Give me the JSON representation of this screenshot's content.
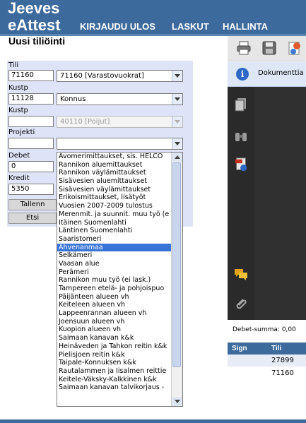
{
  "header": {
    "logo_line1": "Jeeves",
    "logo_line2": "eAttest",
    "nav": [
      "KIRJAUDU ULOS",
      "LASKUT",
      "HALLINTA"
    ]
  },
  "page_title": "Uusi tiliöinti",
  "form": {
    "tili_label": "Tili",
    "tili_value": "71160",
    "tili_select": "71160 [Varastovuokrat]",
    "kustp_label": "Kustp",
    "kustp_value": "11128",
    "kustp_select": "Konnus",
    "kustp2_label": "Kustp",
    "kustp2_value": "",
    "kustp2_select": "40110 [Poijut]",
    "projekti_label": "Projekti",
    "projekti_value": "",
    "projekti_select": "",
    "debet_label": "Debet",
    "debet_value": "0",
    "kredit_label": "Kredit",
    "kredit_value": "5350",
    "save_button": "Tallenn",
    "search_button": "Etsi"
  },
  "dropdown": {
    "items": [
      "Avomerimittaukset, sis. HELCO",
      "Rannikon aluemittaukset",
      "Rannikon väylämittaukset",
      "Sisävesien aluemittaukset",
      "Sisävesien väylämittaukset",
      "Erikoismittaukset, lisätyöt",
      "Vuosien 2007-2009 tulostus",
      "Merenmit. ja suunnit. muu työ (e",
      "Itäinen Suomenlahti",
      "Läntinen Suomenlahti",
      "Saaristomeri",
      "Ahvenanmaa",
      "Selkämeri",
      "Vaasan alue",
      "Perämeri",
      "Rannikon muu työ (ei lask.)",
      "Tampereen etelä- ja pohjoispuo",
      "Päijänteen alueen vh",
      "Keiteleen alueen vh",
      "Lappeenrannan alueen vh",
      "Joensuun alueen vh",
      "Kuopion alueen vh",
      "Saimaan kanavan k&k",
      "Heinäveden ja Tahkon reitin k&k",
      "Pielisjoen reitin k&k",
      "Taipale-Konnuksen k&k",
      "Rautalammen ja Iisalmen reittie",
      "Keitele-Väksky-Kalkkinen k&k",
      "Saimaan kanavan talvikorjaus -"
    ],
    "selected": "Ahvenanmaa"
  },
  "viewer": {
    "info_text": "Dokumenttia t",
    "debet_summa": "Debet-summa: 0,00"
  },
  "table": {
    "headers": [
      "Sign",
      "Tili"
    ],
    "rows": [
      {
        "sign": "",
        "tili": "27899"
      },
      {
        "sign": "",
        "tili": "71160"
      }
    ]
  },
  "colors": {
    "header_bg": "#3d6a9c",
    "form_bg": "#dfe3f7",
    "selected_item": "#3874d8"
  }
}
